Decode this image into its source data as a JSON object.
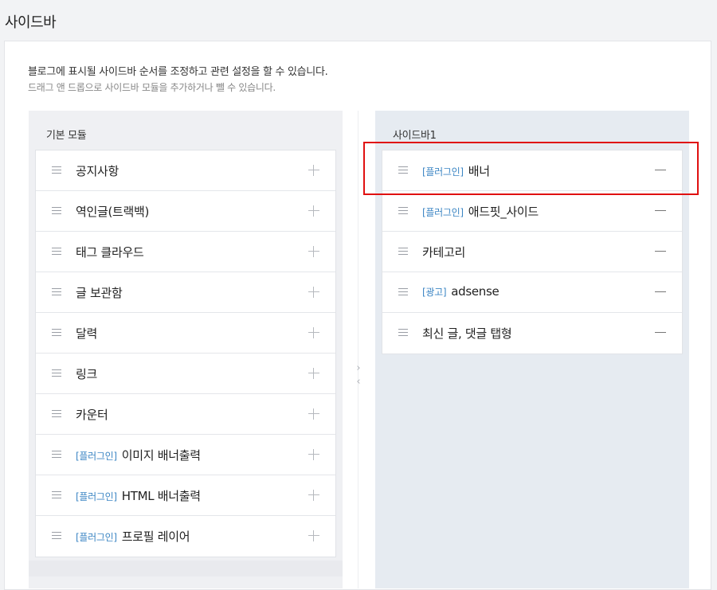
{
  "page": {
    "title": "사이드바"
  },
  "description": {
    "line1": "블로그에 표시될 사이드바 순서를 조정하고 관련 설정을 할 수 있습니다.",
    "line2": "드래그 앤 드롭으로 사이드바 모듈을 추가하거나 뺄 수 있습니다."
  },
  "basic_modules": {
    "title": "기본 모듈",
    "items": [
      {
        "tag": "",
        "label": "공지사항"
      },
      {
        "tag": "",
        "label": "역인글(트랙백)"
      },
      {
        "tag": "",
        "label": "태그 클라우드"
      },
      {
        "tag": "",
        "label": "글 보관함"
      },
      {
        "tag": "",
        "label": "달력"
      },
      {
        "tag": "",
        "label": "링크"
      },
      {
        "tag": "",
        "label": "카운터"
      },
      {
        "tag": "[플러그인]",
        "label": "이미지 배너출력"
      },
      {
        "tag": "[플러그인]",
        "label": "HTML 배너출력"
      },
      {
        "tag": "[플러그인]",
        "label": "프로필 레이어"
      }
    ]
  },
  "sidebar1": {
    "title": "사이드바1",
    "items": [
      {
        "tag": "[플러그인]",
        "label": "배너"
      },
      {
        "tag": "[플러그인]",
        "label": "애드핏_사이드"
      },
      {
        "tag": "",
        "label": "카테고리"
      },
      {
        "tag": "[광고]",
        "label": "adsense"
      },
      {
        "tag": "",
        "label": "최신 글, 댓글 탭형"
      }
    ]
  },
  "arrows": {
    "right": "›",
    "left": "‹"
  },
  "colors": {
    "tag": "#3c86c4",
    "highlight": "#e01010",
    "left_column_bg": "#eff0f3",
    "right_column_bg": "#e6ebf1"
  }
}
